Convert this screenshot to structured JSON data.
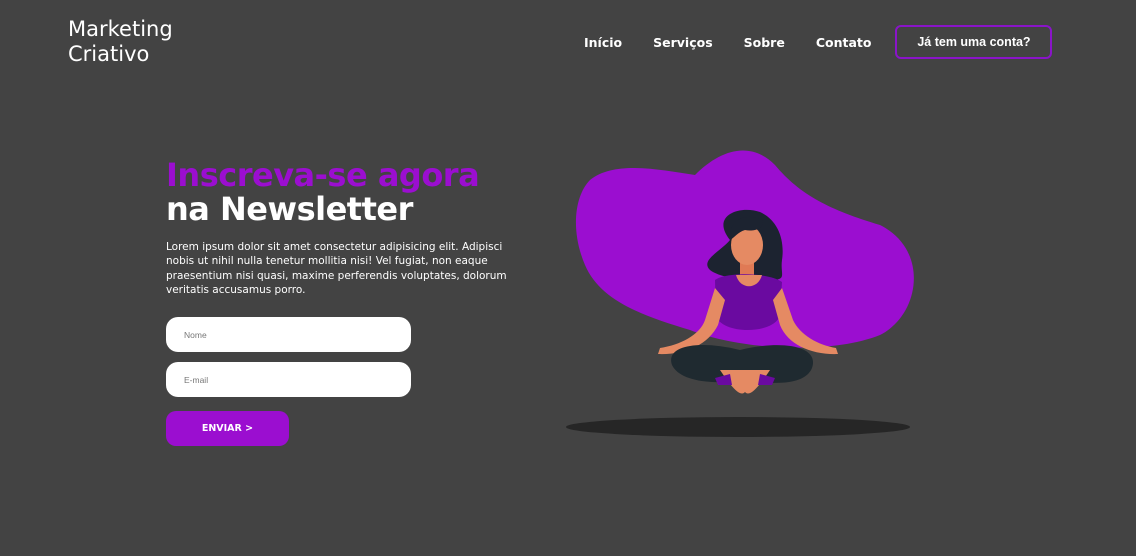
{
  "brand": {
    "line1": "Marketing",
    "line2": "Criativo"
  },
  "nav": {
    "items": [
      "Início",
      "Serviços",
      "Sobre",
      "Contato"
    ],
    "login_label": "Já tem uma conta?"
  },
  "hero": {
    "title_accent": "Inscreva-se agora",
    "title_main": "na Newsletter",
    "body": "Lorem ipsum dolor sit amet consectetur adipisicing elit. Adipisci nobis ut nihil nulla tenetur mollitia nisi! Vel fugiat, non eaque praesentium nisi quasi, maxime perferendis voluptates, dolorum veritatis accusamus porro."
  },
  "form": {
    "name_placeholder": "Nome",
    "email_placeholder": "E-mail",
    "submit_label": "ENVIAR >"
  },
  "colors": {
    "background": "#434343",
    "accent": "#9b0ed0",
    "text": "#ffffff"
  }
}
